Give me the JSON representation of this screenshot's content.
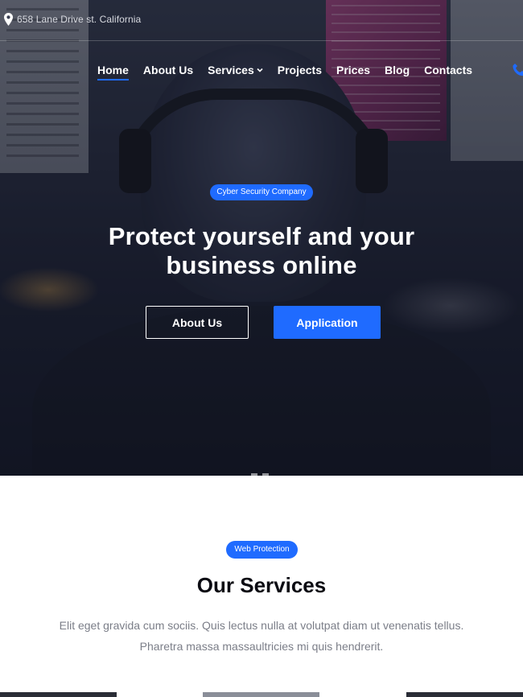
{
  "topbar": {
    "address": "658 Lane Drive st. California",
    "address_icon": "map-pin-icon"
  },
  "nav": {
    "items": [
      {
        "label": "Home",
        "active": true
      },
      {
        "label": "About Us",
        "active": false
      },
      {
        "label": "Services",
        "active": false,
        "has_dropdown": true
      },
      {
        "label": "Projects",
        "active": false
      },
      {
        "label": "Prices",
        "active": false
      },
      {
        "label": "Blog",
        "active": false
      },
      {
        "label": "Contacts",
        "active": false
      }
    ],
    "phone_icon": "phone-icon"
  },
  "hero": {
    "badge": "Cyber Security Company",
    "title": "Protect yourself and your business online",
    "primary_button": "Application",
    "secondary_button": "About Us"
  },
  "services": {
    "badge": "Web Protection",
    "title": "Our Services",
    "description_line1": "Elit eget gravida cum sociis. Quis lectus nulla at volutpat diam ut venenatis tellus.",
    "description_line2": "Pharetra massa massaultricies mi quis hendrerit."
  },
  "colors": {
    "accent": "#1f6bff",
    "hero_text": "#ffffff",
    "heading": "#0b0b12",
    "body_text": "#7b7e88"
  }
}
